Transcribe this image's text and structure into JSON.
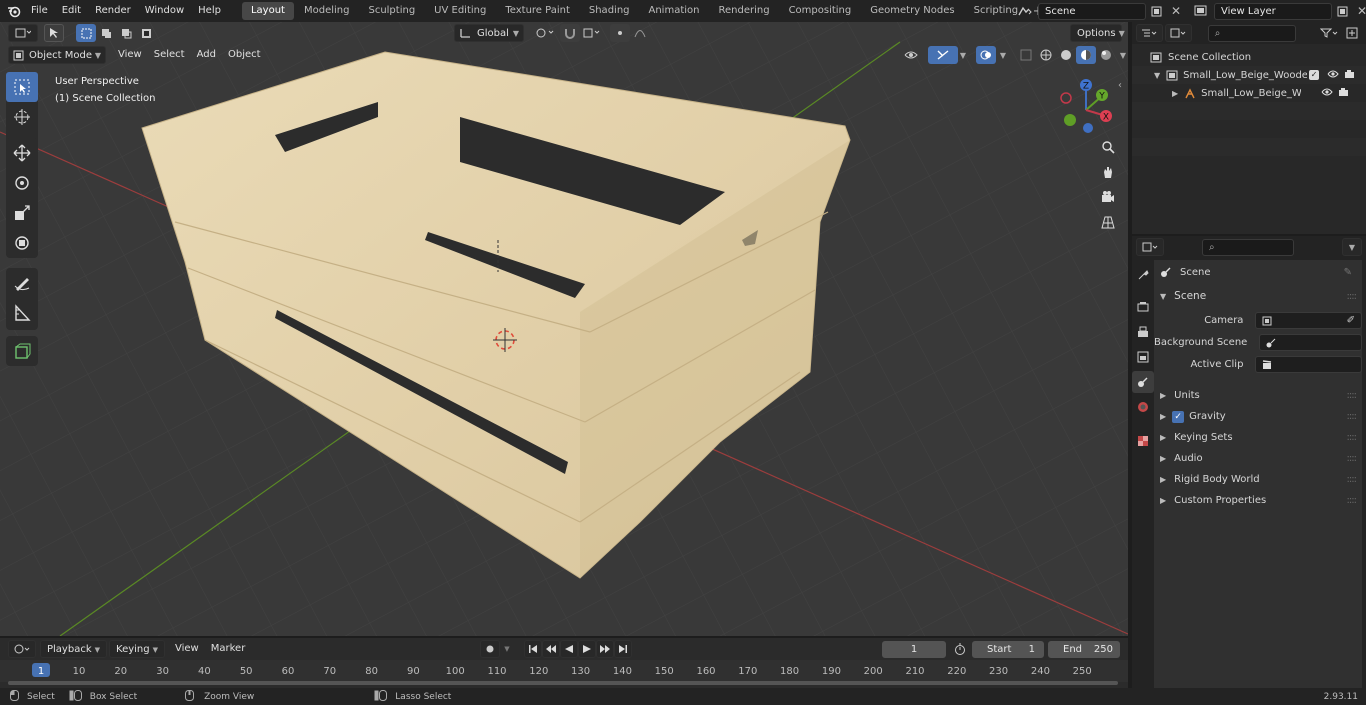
{
  "topbar": {
    "menus": [
      "File",
      "Edit",
      "Render",
      "Window",
      "Help"
    ],
    "workspaces": [
      "Layout",
      "Modeling",
      "Sculpting",
      "UV Editing",
      "Texture Paint",
      "Shading",
      "Animation",
      "Rendering",
      "Compositing",
      "Geometry Nodes",
      "Scripting"
    ],
    "active_workspace": "Layout",
    "scene_field": "Scene",
    "view_layer_field": "View Layer"
  },
  "viewport_header": {
    "mode": "Object Mode",
    "menus": [
      "View",
      "Select",
      "Add",
      "Object"
    ],
    "transform_orientation": "Global",
    "options_label": "Options"
  },
  "viewport_overlay": {
    "perspective": "User Perspective",
    "collection": "(1) Scene Collection"
  },
  "gizmo": {
    "z": "Z",
    "y": "Y",
    "x": "X"
  },
  "outliner": {
    "root": "Scene Collection",
    "items": [
      {
        "label": "Small_Low_Beige_Wooden_F"
      },
      {
        "label": "Small_Low_Beige_Wood"
      }
    ]
  },
  "properties": {
    "context": "Scene",
    "section": "Scene",
    "fields": [
      {
        "label": "Camera",
        "value": ""
      },
      {
        "label": "Background Scene",
        "value": ""
      },
      {
        "label": "Active Clip",
        "value": ""
      }
    ],
    "panels": [
      "Units",
      "Gravity",
      "Keying Sets",
      "Audio",
      "Rigid Body World",
      "Custom Properties"
    ],
    "gravity_checked": true
  },
  "timeline": {
    "menus": [
      "Playback",
      "Keying",
      "View",
      "Marker"
    ],
    "current_frame": "1",
    "start_label": "Start",
    "start_value": "1",
    "end_label": "End",
    "end_value": "250",
    "ruler": [
      "1",
      "10",
      "20",
      "30",
      "40",
      "50",
      "60",
      "70",
      "80",
      "90",
      "100",
      "110",
      "120",
      "130",
      "140",
      "150",
      "160",
      "170",
      "180",
      "190",
      "200",
      "210",
      "220",
      "230",
      "240",
      "250"
    ]
  },
  "statusbar": {
    "items": [
      "Select",
      "Box Select",
      "Zoom View",
      "Lasso Select"
    ],
    "version": "2.93.11"
  },
  "colors": {
    "accent": "#4772b3",
    "crate": "#e4d3ae",
    "x_axis": "#a33b3b",
    "y_axis": "#5e8a26"
  }
}
